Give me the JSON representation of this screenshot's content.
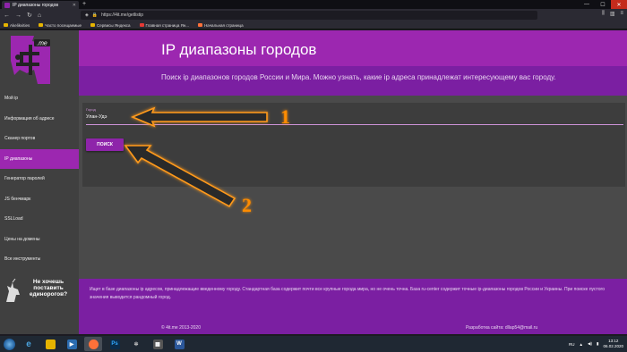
{
  "browser": {
    "tab_title": "IP диапазоны городов",
    "url": "https://4it.me/getlistip",
    "bookmarks": [
      "Akelikvities",
      "Часто посещаемые",
      "Сервисы Яндекса",
      "Главная страница Ян...",
      "Начальная страница"
    ]
  },
  "sidebar": {
    "items": [
      {
        "label": "Мой ip"
      },
      {
        "label": "Информация об адресе"
      },
      {
        "label": "Сканер портов"
      },
      {
        "label": "IP диапазоны"
      },
      {
        "label": "Генератор паролей"
      },
      {
        "label": "JS бенчмарк"
      },
      {
        "label": "SSLLoad"
      },
      {
        "label": "Цены на домены"
      },
      {
        "label": "Все инструменты"
      }
    ],
    "unicorn_text": "Не хочешь поставить единорогов?"
  },
  "header": {
    "title": "IP диапазоны городов",
    "subtitle": "Поиск ip диапазонов городов России и Мира. Можно узнать, какие ip адреса принадлежат интересующему вас городу."
  },
  "search": {
    "field_label": "Город",
    "field_value": "Улан-Удэ",
    "button_label": "ПОИСК"
  },
  "annotations": {
    "label_1": "1",
    "label_2": "2"
  },
  "footer": {
    "text": "Ищет в базе диапазоны ip адресов, принадлежащие введенному городу. Стандартная база содержит почти все крупные города мира, но не очень точна. База ru-center содержит точные ip-диапазоны городов России и Украины. При поиске пустого значения выводится рандомный город.",
    "copyright": "© 4it.me 2013-2020",
    "developer": "Разработка сайта: dllap54@mail.ru"
  },
  "taskbar": {
    "lang": "RU",
    "time": "13:12",
    "date": "06.02.2020"
  }
}
